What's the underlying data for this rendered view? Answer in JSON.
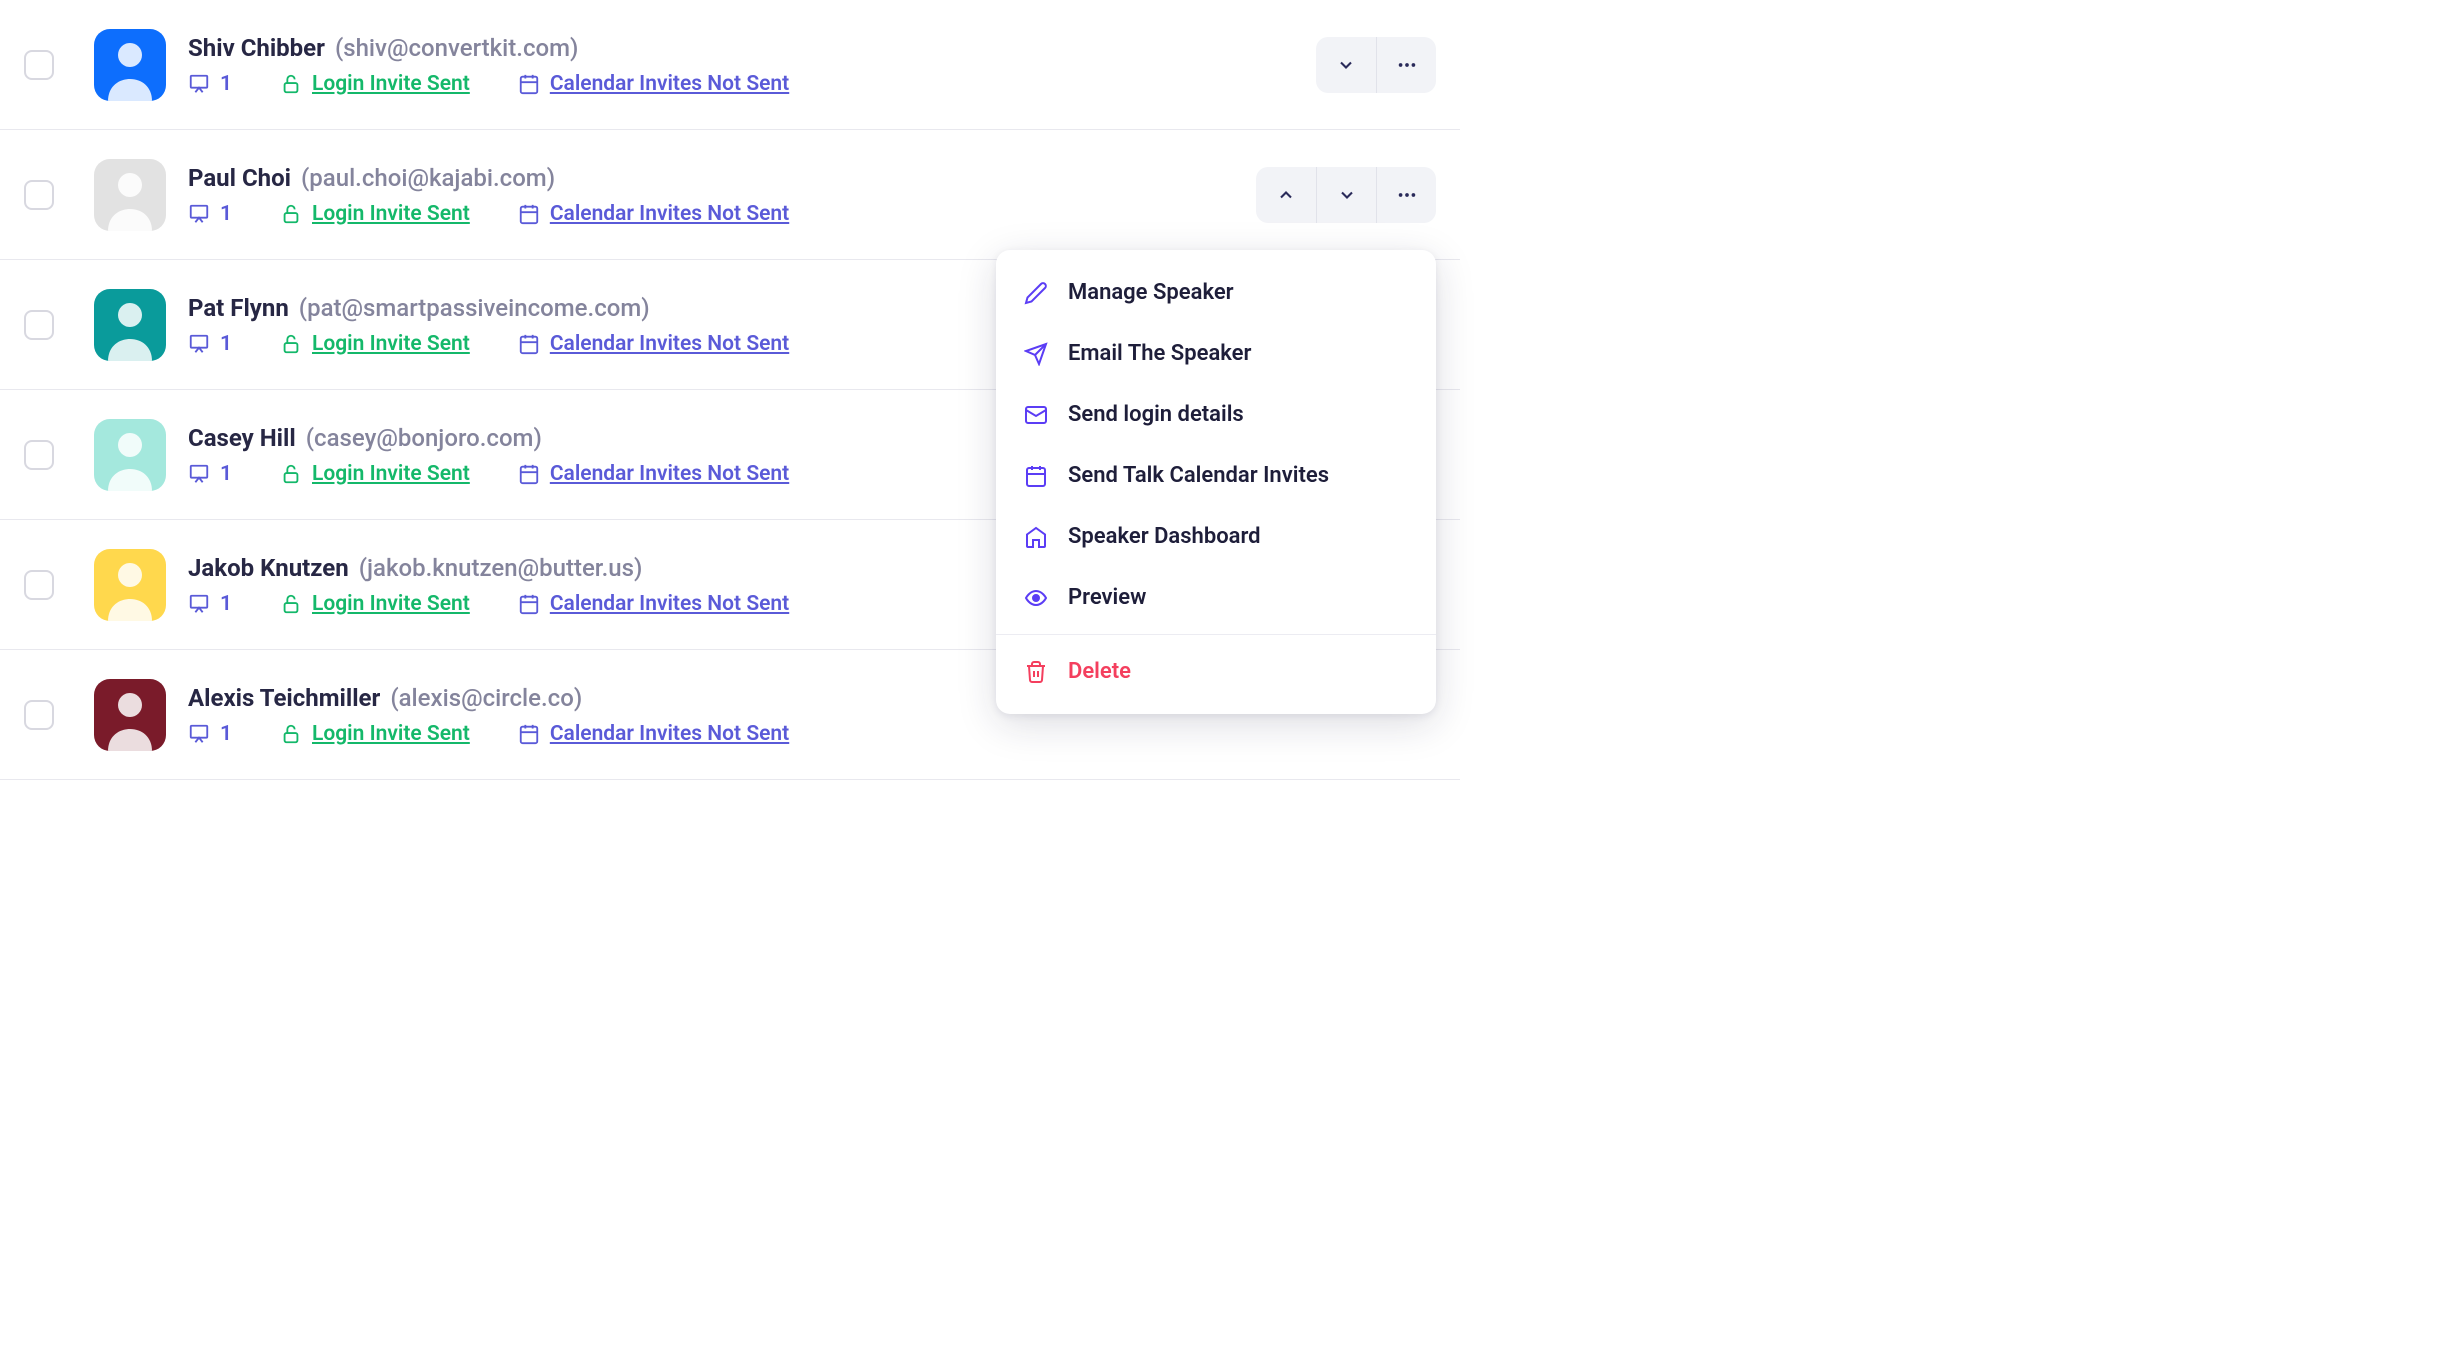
{
  "labels": {
    "login_invite": "Login Invite Sent",
    "calendar_invite": "Calendar Invites Not Sent"
  },
  "menu": {
    "manage": "Manage Speaker",
    "email": "Email The Speaker",
    "login_details": "Send login details",
    "calendar_invites": "Send Talk Calendar Invites",
    "dashboard": "Speaker Dashboard",
    "preview": "Preview",
    "delete": "Delete"
  },
  "speakers": [
    {
      "name": "Shiv Chibber",
      "email": "(shiv@convertkit.com)",
      "count": "1",
      "show_up": false,
      "avatar_bg": "#0d6efd"
    },
    {
      "name": "Paul Choi",
      "email": "(paul.choi@kajabi.com)",
      "count": "1",
      "show_up": true,
      "avatar_bg": "#e2e2e2"
    },
    {
      "name": "Pat Flynn",
      "email": "(pat@smartpassiveincome.com)",
      "count": "1",
      "show_up": true,
      "avatar_bg": "#0a9b9b"
    },
    {
      "name": "Casey Hill",
      "email": "(casey@bonjoro.com)",
      "count": "1",
      "show_up": true,
      "avatar_bg": "#a4e8dd"
    },
    {
      "name": "Jakob Knutzen",
      "email": "(jakob.knutzen@butter.us)",
      "count": "1",
      "show_up": true,
      "avatar_bg": "#ffd84d"
    },
    {
      "name": "Alexis Teichmiller",
      "email": "(alexis@circle.co)",
      "count": "1",
      "show_up": true,
      "avatar_bg": "#7a1b2a"
    }
  ]
}
